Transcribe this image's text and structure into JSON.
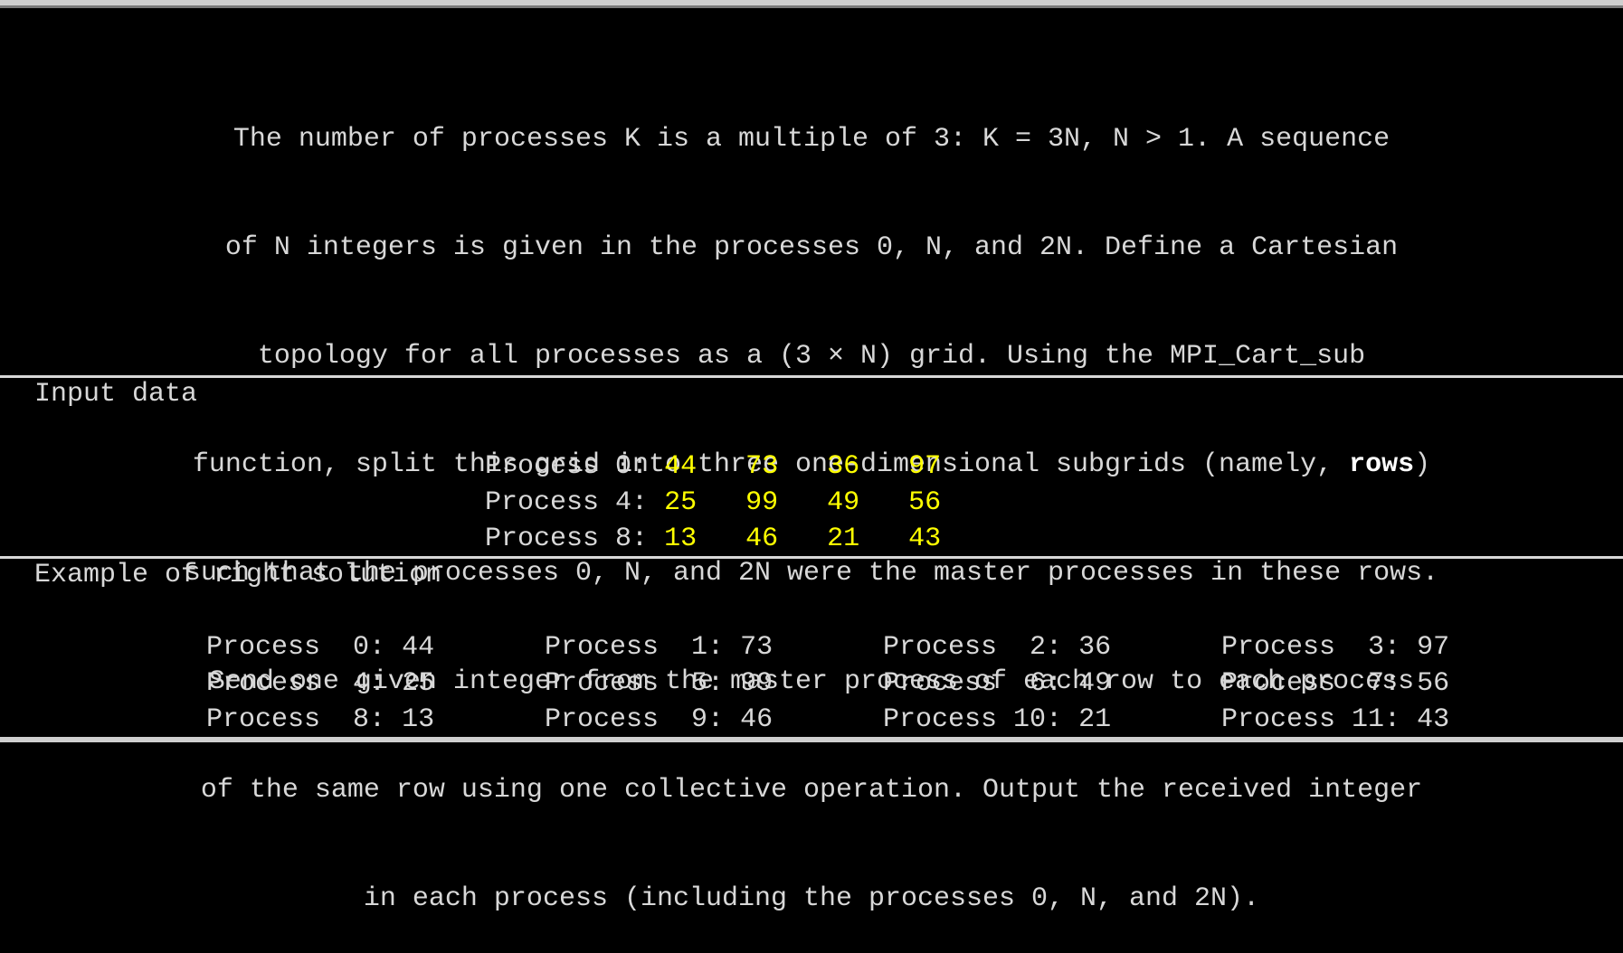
{
  "task": {
    "line1": "The number of processes K is a multiple of 3: K = 3N, N > 1. A sequence",
    "line2": "of N integers is given in the processes 0, N, and 2N. Define a Cartesian",
    "line3": "topology for all processes as a (3 × N) grid. Using the MPI_Cart_sub",
    "line4_a": "function, split this grid into three one-dimensional subgrids (namely, ",
    "line4_bold": "rows",
    "line4_b": ")",
    "line5": "such that the processes 0, N, and 2N were the master processes in these rows.",
    "line6": "Send one given integer from the master process of each row to each process",
    "line7": "of the same row using one collective operation. Output the received integer",
    "line8": "in each process (including the processes 0, N, and 2N)."
  },
  "input": {
    "title": "Input data",
    "rows": [
      {
        "label": "Process 0: ",
        "values": [
          "44",
          "73",
          "36",
          "97"
        ]
      },
      {
        "label": "Process 4: ",
        "values": [
          "25",
          "99",
          "49",
          "56"
        ]
      },
      {
        "label": "Process 8: ",
        "values": [
          "13",
          "46",
          "21",
          "43"
        ]
      }
    ]
  },
  "solution": {
    "title": "Example of right solution",
    "rows": [
      [
        {
          "label": "Process  0:",
          "value": " 44"
        },
        {
          "label": "Process  1:",
          "value": " 73"
        },
        {
          "label": "Process  2:",
          "value": " 36"
        },
        {
          "label": "Process  3:",
          "value": " 97"
        }
      ],
      [
        {
          "label": "Process  4:",
          "value": " 25"
        },
        {
          "label": "Process  5:",
          "value": " 99"
        },
        {
          "label": "Process  6:",
          "value": " 49"
        },
        {
          "label": "Process  7:",
          "value": " 56"
        }
      ],
      [
        {
          "label": "Process  8:",
          "value": " 13"
        },
        {
          "label": "Process  9:",
          "value": " 46"
        },
        {
          "label": "Process 10:",
          "value": " 21"
        },
        {
          "label": "Process 11:",
          "value": " 43"
        }
      ]
    ]
  }
}
